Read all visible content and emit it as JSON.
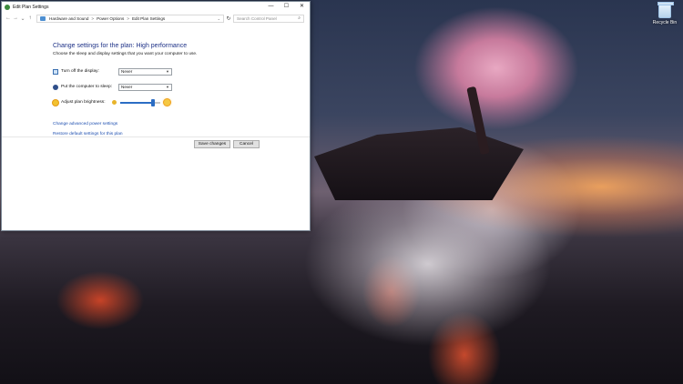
{
  "window": {
    "title": "Edit Plan Settings",
    "minimize": "—",
    "maximize": "☐",
    "close": "✕"
  },
  "address": {
    "breadcrumb": [
      "Hardware and Sound",
      "Power Options",
      "Edit Plan Settings"
    ],
    "separator": ">",
    "search_placeholder": "Search Control Panel"
  },
  "main": {
    "heading": "Change settings for the plan: High performance",
    "subtext": "Choose the sleep and display settings that you want your computer to use.",
    "settings": [
      {
        "label": "Turn off the display:",
        "value": "Never",
        "icon": "monitor-icon"
      },
      {
        "label": "Put the computer to sleep:",
        "value": "Never",
        "icon": "sleep-icon"
      }
    ],
    "brightness_label": "Adjust plan brightness:",
    "brightness_level": 0.85,
    "links": [
      "Change advanced power settings",
      "Restore default settings for this plan"
    ]
  },
  "buttons": {
    "save": "Save changes",
    "cancel": "Cancel"
  },
  "desktop": {
    "recycle_bin_label": "Recycle Bin"
  },
  "colors": {
    "heading": "#1e3287",
    "link": "#1e4fb0",
    "accent": "#2b6dc4"
  }
}
